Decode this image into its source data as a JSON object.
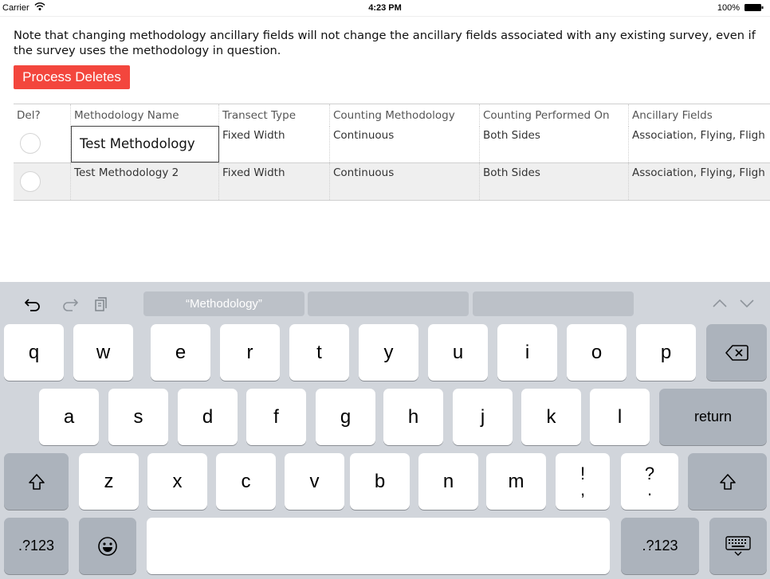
{
  "status_bar": {
    "carrier": "Carrier",
    "time": "4:23 PM",
    "battery": "100%"
  },
  "note": "Note that changing methodology ancillary fields will not change the ancillary fields associated with any existing survey, even if the survey uses the methodology in question.",
  "process_button": "Process Deletes",
  "table": {
    "headers": [
      "Del?",
      "Methodology Name",
      "Transect Type",
      "Counting Methodology",
      "Counting Performed On",
      "Ancillary Fields"
    ],
    "rows": [
      {
        "name": "Test Methodology",
        "transect": "Fixed Width",
        "counting": "Continuous",
        "performed_on": "Both Sides",
        "ancillary": "Association, Flying, Fligh",
        "editing": true
      },
      {
        "name": "Test Methodology 2",
        "transect": "Fixed Width",
        "counting": "Continuous",
        "performed_on": "Both Sides",
        "ancillary": "Association, Flying, Fligh",
        "editing": false
      }
    ]
  },
  "keyboard": {
    "suggestions": [
      "“Methodology”",
      "",
      ""
    ],
    "row1": [
      "q",
      "w",
      "e",
      "r",
      "t",
      "y",
      "u",
      "i",
      "o",
      "p"
    ],
    "row2": [
      "a",
      "s",
      "d",
      "f",
      "g",
      "h",
      "j",
      "k",
      "l"
    ],
    "row3": [
      "z",
      "x",
      "c",
      "v",
      "b",
      "n",
      "m"
    ],
    "punct1": [
      "!",
      ","
    ],
    "punct2": [
      "?",
      "."
    ],
    "return_label": "return",
    "numbers_label": ".?123",
    "icons": [
      "undo-icon",
      "redo-icon",
      "paste-icon",
      "chevron-up-icon",
      "chevron-down-icon",
      "backspace-icon",
      "shift-icon",
      "emoji-icon",
      "keyboard-dismiss-icon"
    ]
  }
}
